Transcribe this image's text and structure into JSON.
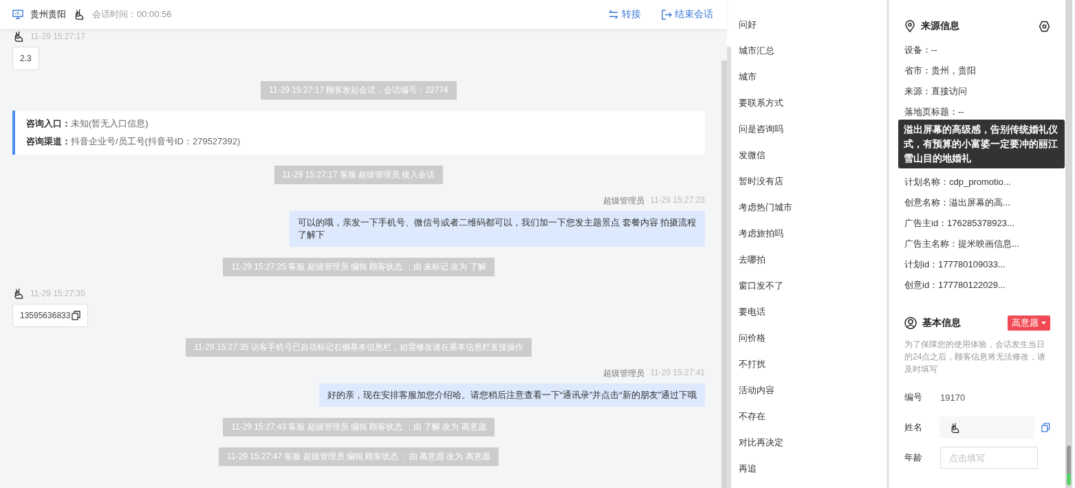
{
  "header": {
    "location": "贵州贵阳",
    "session_time": "会话时间：00:00:56",
    "actions": [
      {
        "kind": "transfer",
        "label": "转接"
      },
      {
        "kind": "end",
        "label": "结束会话"
      }
    ]
  },
  "messages": [
    {
      "kind": "visitor",
      "time": "11-29 15:27:17",
      "text": "2.3",
      "copyable": false
    },
    {
      "kind": "system",
      "text": "11-29 15:27:17 顾客发起会话，会话编号：22774"
    },
    {
      "kind": "info",
      "lines": [
        {
          "label": "咨询入口：",
          "value": "未知(暂无入口信息)"
        },
        {
          "label": "咨询渠道：",
          "value": "抖音企业号/员工号(抖音号ID：279527392)"
        }
      ]
    },
    {
      "kind": "system",
      "text": "11-29 15:27:17 客服 超级管理员 接入会话"
    },
    {
      "kind": "agent",
      "name": "超级管理员",
      "time": "11-29 15:27:23",
      "text": "可以的哦，亲发一下手机号、微信号或者二维码都可以，我们加一下您发主题景点 套餐内容 拍摄流程了解下"
    },
    {
      "kind": "system",
      "text": "11-29 15:27:25 客服 超级管理员 编辑 顾客状态 ：由 未标记 改为 了解"
    },
    {
      "kind": "visitor",
      "time": "11-29 15:27:35",
      "text": "13595636833",
      "copyable": true
    },
    {
      "kind": "system",
      "text": "11-29 15:27:35 访客手机号已自动标记右侧基本信息栏，如需修改请在基本信息栏直接操作"
    },
    {
      "kind": "agent",
      "name": "超级管理员",
      "time": "11-29 15:27:41",
      "text": "好的亲，现在安排客服加您介绍哈。请您稍后注意查看一下“通讯录”并点击“新的朋友”通过下哦"
    },
    {
      "kind": "system",
      "text": "11-29 15:27:43 客服 超级管理员 编辑 顾客状态 ：由 了解 改为 高意愿"
    },
    {
      "kind": "system",
      "text": "11-29 15:27:47 客服 超级管理员 编辑 顾客状态 ：由 高意愿 改为 高意愿"
    }
  ],
  "quick_replies": [
    "问好",
    "城市汇总",
    "城市",
    "要联系方式",
    "问是咨询吗",
    "发微信",
    "暂时没有店",
    "考虑热门城市",
    "考虑旅拍吗",
    "去哪拍",
    "窗口发不了",
    "要电话",
    "问价格",
    "不打扰",
    "活动内容",
    "不存在",
    "对比再决定",
    "再追"
  ],
  "source": {
    "title": "来源信息",
    "rows": [
      "设备：--",
      "省市：贵州，贵阳",
      "来源：直接访问",
      "落地页标题：--"
    ],
    "tooltip": "溢出屏幕的高级感，告别传统婚礼仪式，有预算的小富婆一定要冲的丽江雪山目的地婚礼",
    "more_rows": [
      "计划名称：cdp_promotio...",
      "创意名称：溢出屏幕的高...",
      "广告主id：176285378923...",
      "广告主名称：提米映画信息...",
      "计划id：177780109033...",
      "创意id：177780122029..."
    ]
  },
  "basic": {
    "title": "基本信息",
    "status": "高意愿",
    "notice": "为了保障您的使用体验，会话发生当日的24点之后，顾客信息将无法修改，请及时填写",
    "fields": [
      {
        "kind": "text",
        "label": "编号",
        "value": "19170"
      },
      {
        "kind": "icon",
        "label": "姓名"
      },
      {
        "kind": "input",
        "label": "年龄",
        "placeholder": "点击填写"
      }
    ]
  }
}
